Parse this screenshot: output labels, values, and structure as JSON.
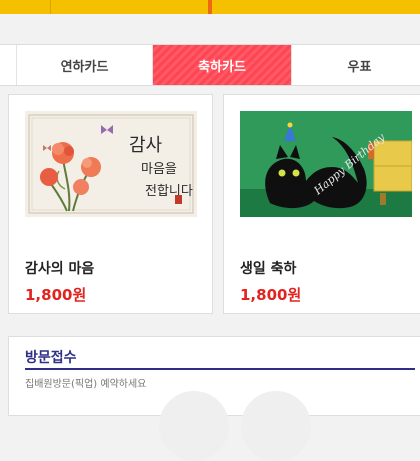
{
  "tabs": [
    {
      "label": "연하카드"
    },
    {
      "label": "축하카드"
    },
    {
      "label": "우표"
    }
  ],
  "products": [
    {
      "name": "감사의 마음",
      "price": "1,800원",
      "image_text": "감사의 마음을 전합니다"
    },
    {
      "name": "생일 축하",
      "price": "1,800원",
      "image_text": "Happy Birthday"
    }
  ],
  "visit": {
    "title": "방문접수",
    "subtitle": "집배원방문(픽업) 예약하세요"
  },
  "colors": {
    "topbar": "#f5c000",
    "active_tab": "#ff4553",
    "price": "#e1241f",
    "visit_title": "#2f2f88"
  }
}
